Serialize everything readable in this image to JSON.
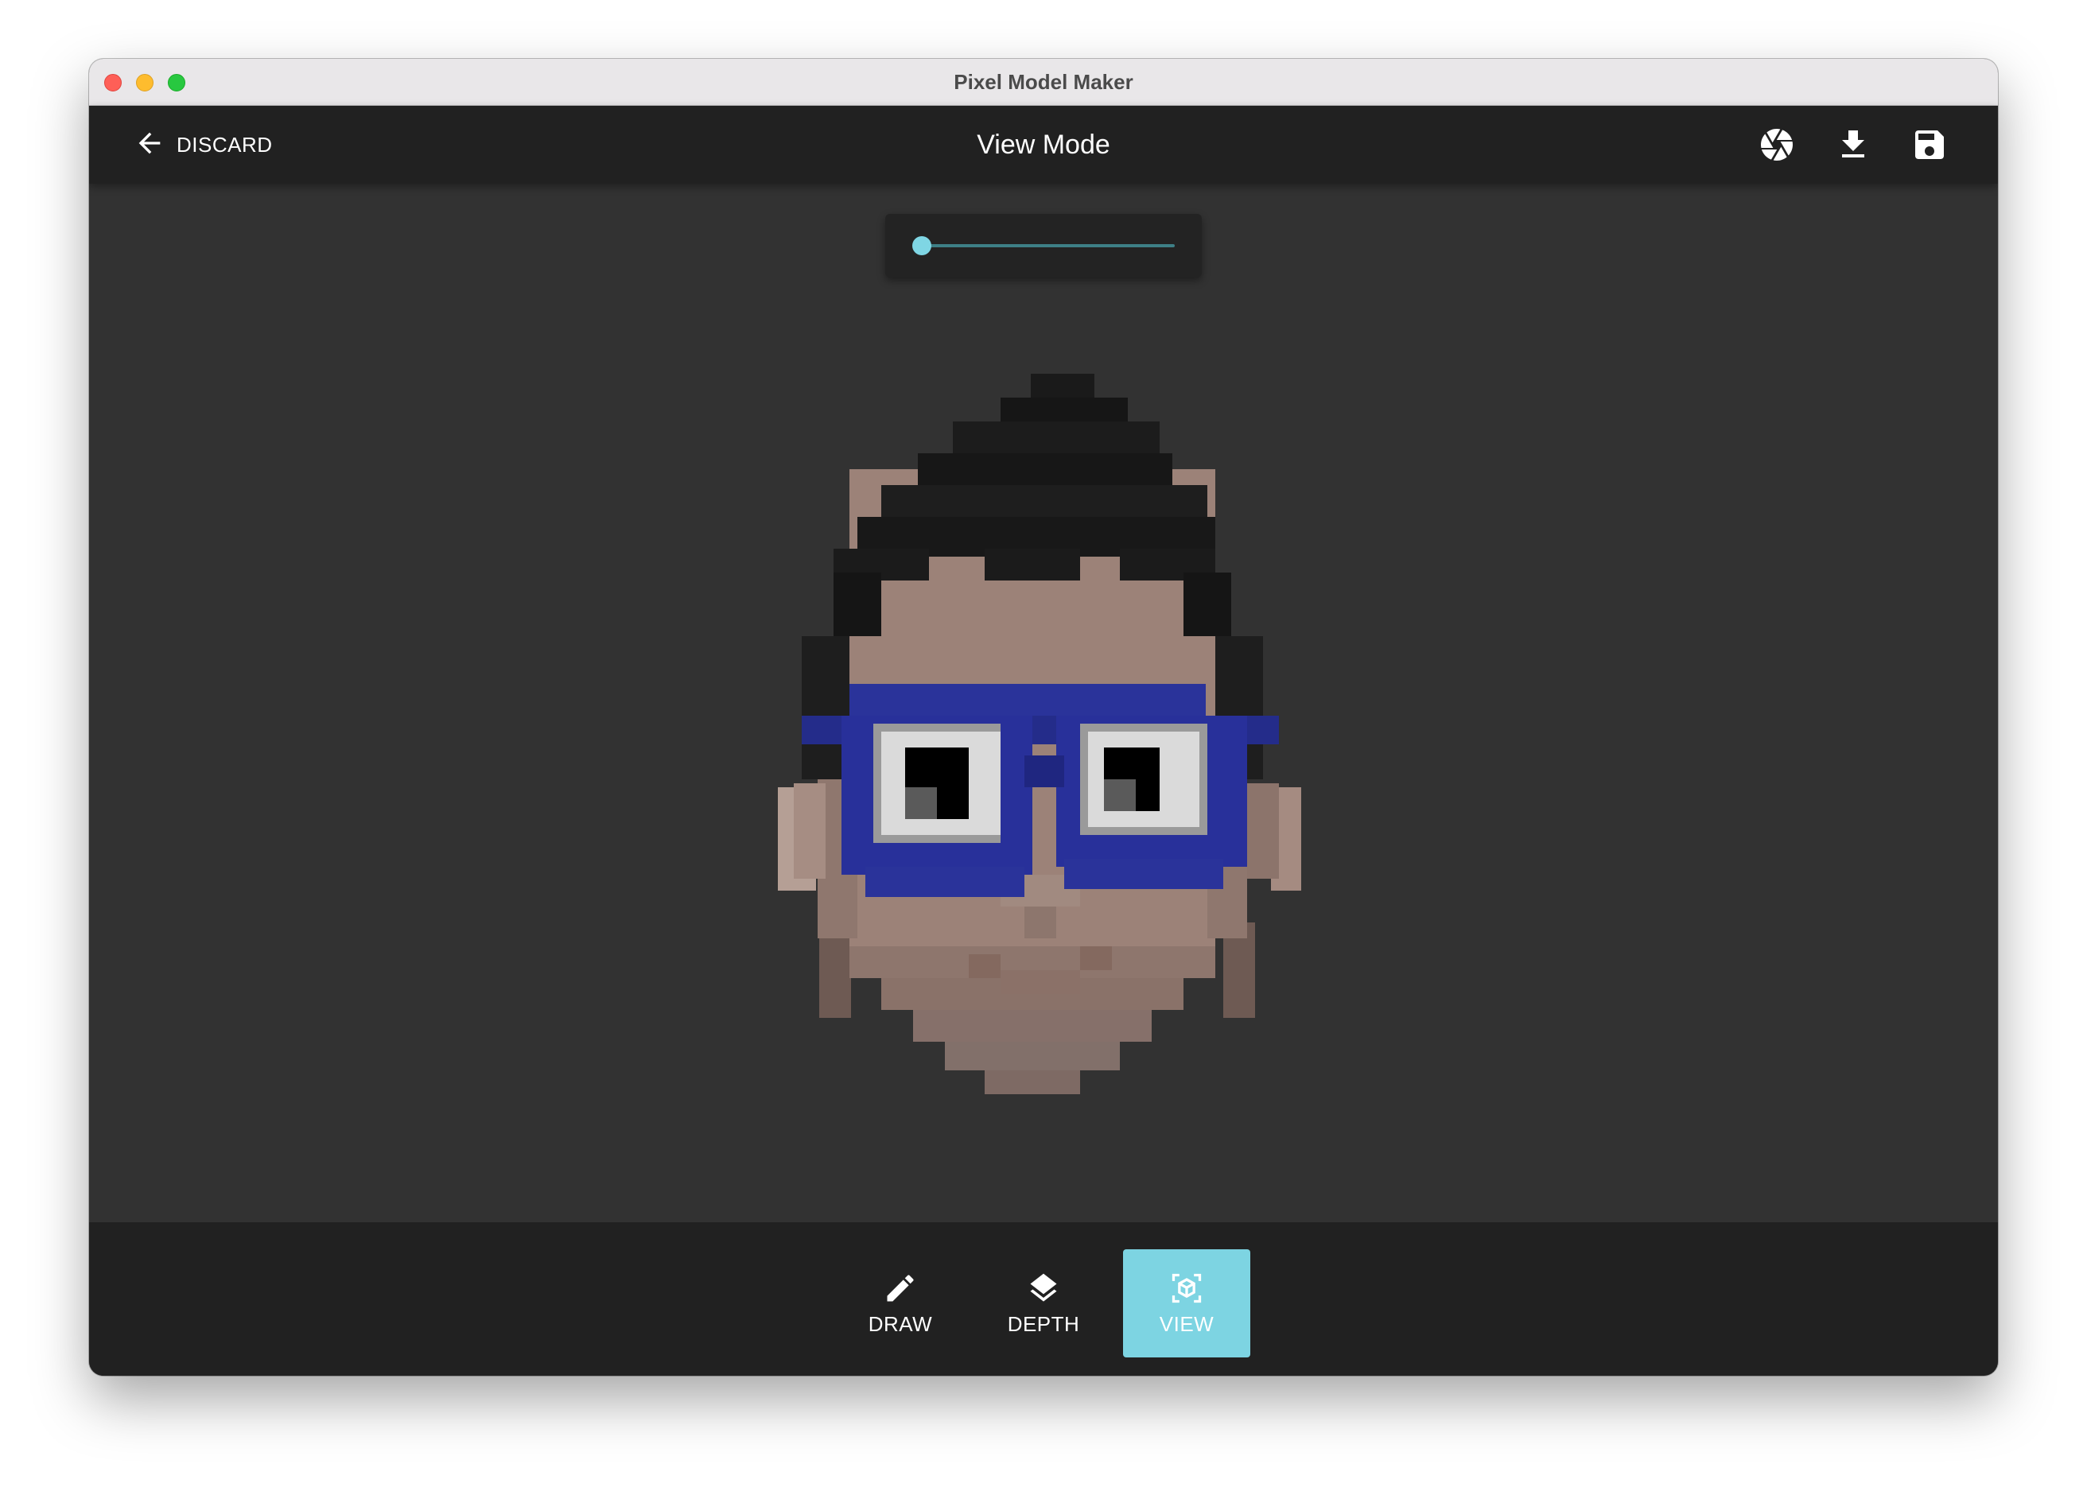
{
  "window": {
    "title": "Pixel Model Maker"
  },
  "appbar": {
    "discard_label": "DISCARD",
    "title": "View Mode",
    "actions": [
      "aperture-icon",
      "download-icon",
      "save-icon"
    ]
  },
  "slider": {
    "value": 0.0
  },
  "bottom_nav": {
    "tabs": [
      {
        "label": "DRAW",
        "icon": "pencil-icon",
        "active": false
      },
      {
        "label": "DEPTH",
        "icon": "layers-icon",
        "active": false
      },
      {
        "label": "VIEW",
        "icon": "cube-scan-icon",
        "active": true
      }
    ]
  },
  "colors": {
    "accent": "#7dd4e2",
    "appbar": "#212121",
    "canvas": "#323232",
    "skin": "#9c8278",
    "hair": "#1c1c1c",
    "glasses": "#2a339a"
  }
}
